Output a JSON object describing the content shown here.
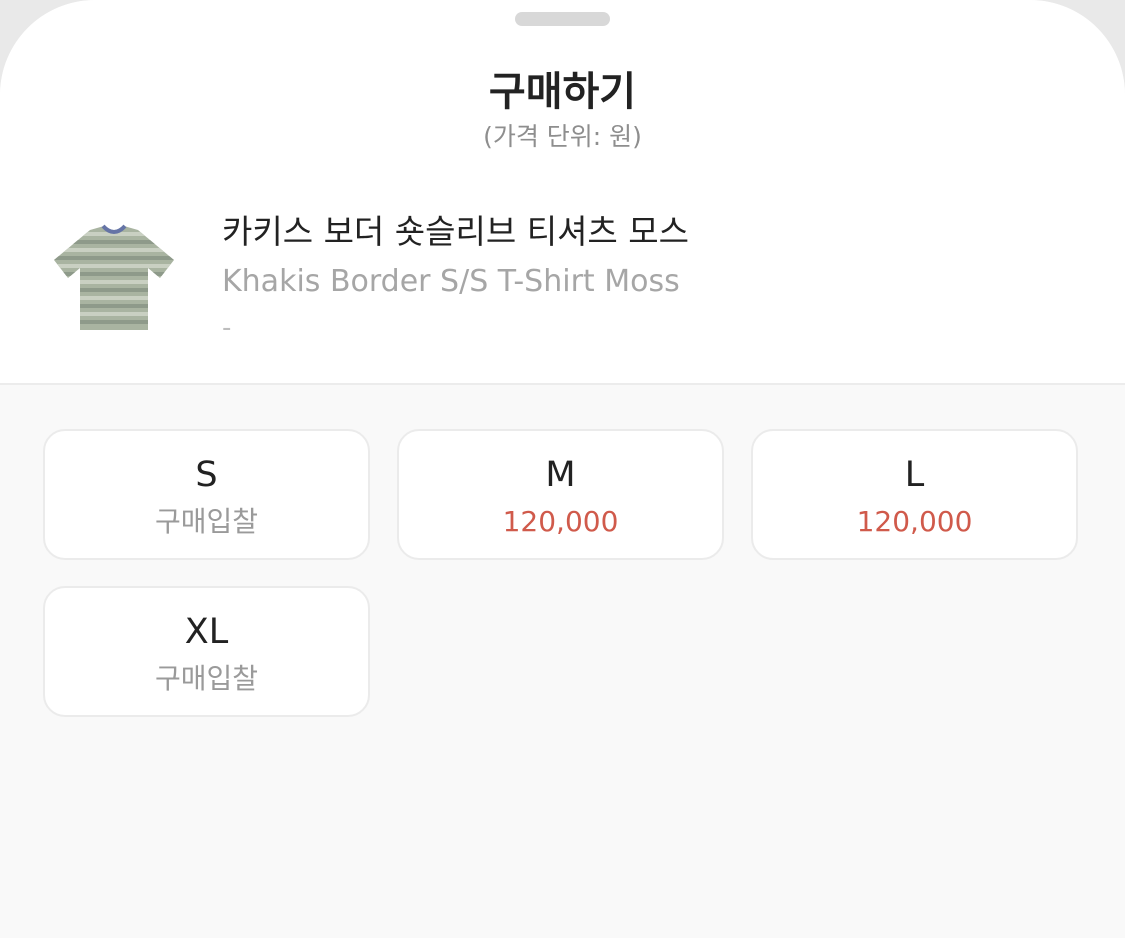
{
  "header": {
    "title": "구매하기",
    "subtitle": "(가격 단위: 원)"
  },
  "product": {
    "name_ko": "카키스 보더 숏슬리브 티셔츠 모스",
    "name_en": "Khakis Border S/S T-Shirt Moss",
    "extra": "-",
    "image_icon": "striped-tshirt-image"
  },
  "sizes": [
    {
      "size": "S",
      "price": "구매입찰"
    },
    {
      "size": "M",
      "price": "120,000"
    },
    {
      "size": "L",
      "price": "120,000"
    },
    {
      "size": "XL",
      "price": "구매입찰"
    }
  ],
  "colors": {
    "price_accent": "#d05a4b",
    "bid_text": "#9a9a9a"
  }
}
